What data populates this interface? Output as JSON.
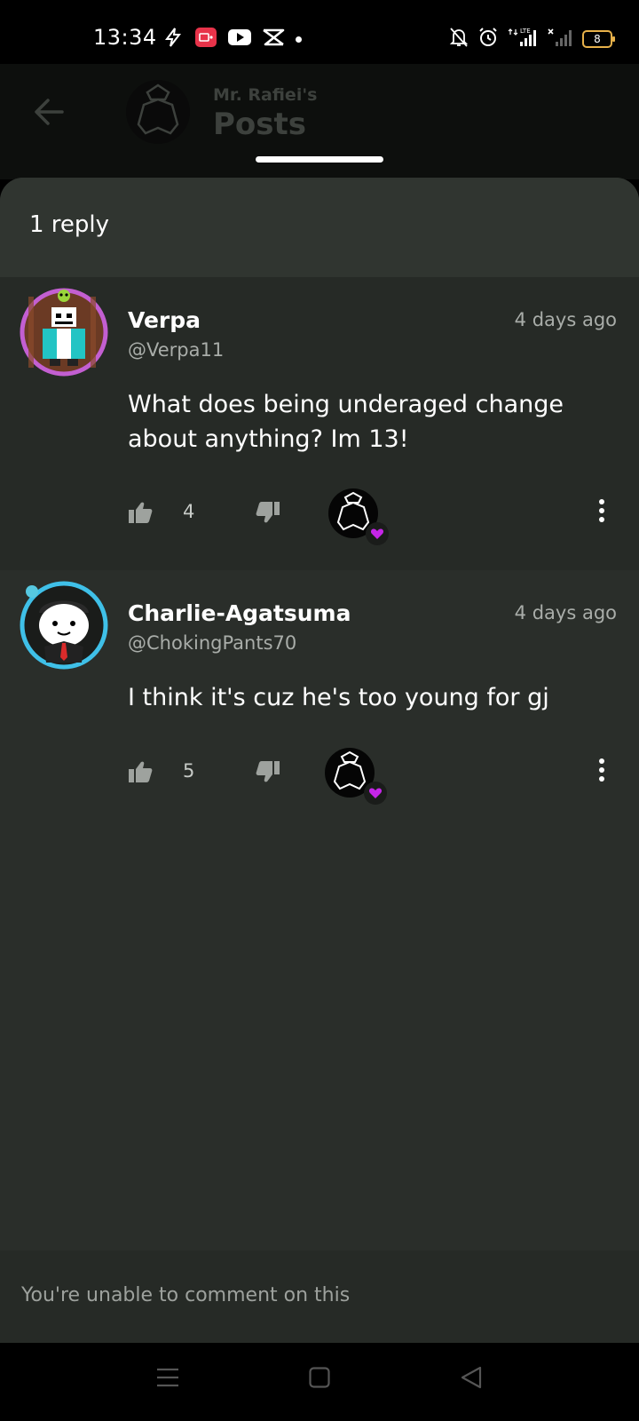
{
  "status_bar": {
    "time": "13:34",
    "battery_level": "8",
    "network_label": "LTE",
    "icons_left": [
      "flash-icon",
      "screen-record-icon",
      "youtube-icon",
      "capcut-icon",
      "dot-icon"
    ],
    "icons_right": [
      "bell-off-icon",
      "alarm-icon",
      "signal-lte-icon",
      "signal-no-service-icon",
      "battery-icon"
    ]
  },
  "background_page": {
    "subtitle": "Mr. Rafiei's",
    "title": "Posts"
  },
  "sheet": {
    "reply_count": "1 reply",
    "comments": [
      {
        "name": "Verpa",
        "handle": "@Verpa11",
        "time": "4 days ago",
        "text": "What does being underaged change about anything? Im 13!",
        "likes": "4",
        "avatar_ring_color": "#c35fd1"
      },
      {
        "name": "Charlie-Agatsuma",
        "handle": "@ChokingPants70",
        "time": "4 days ago",
        "text": "I think it's cuz he's too young for gj",
        "likes": "5",
        "avatar_ring_color": "#3fc0e8"
      }
    ]
  },
  "footer": {
    "unable_text": "You're unable to comment on this"
  },
  "colors": {
    "sheet_bg": "#2a2e2a",
    "header_bg": "#303530",
    "heart": "#c625e8"
  }
}
